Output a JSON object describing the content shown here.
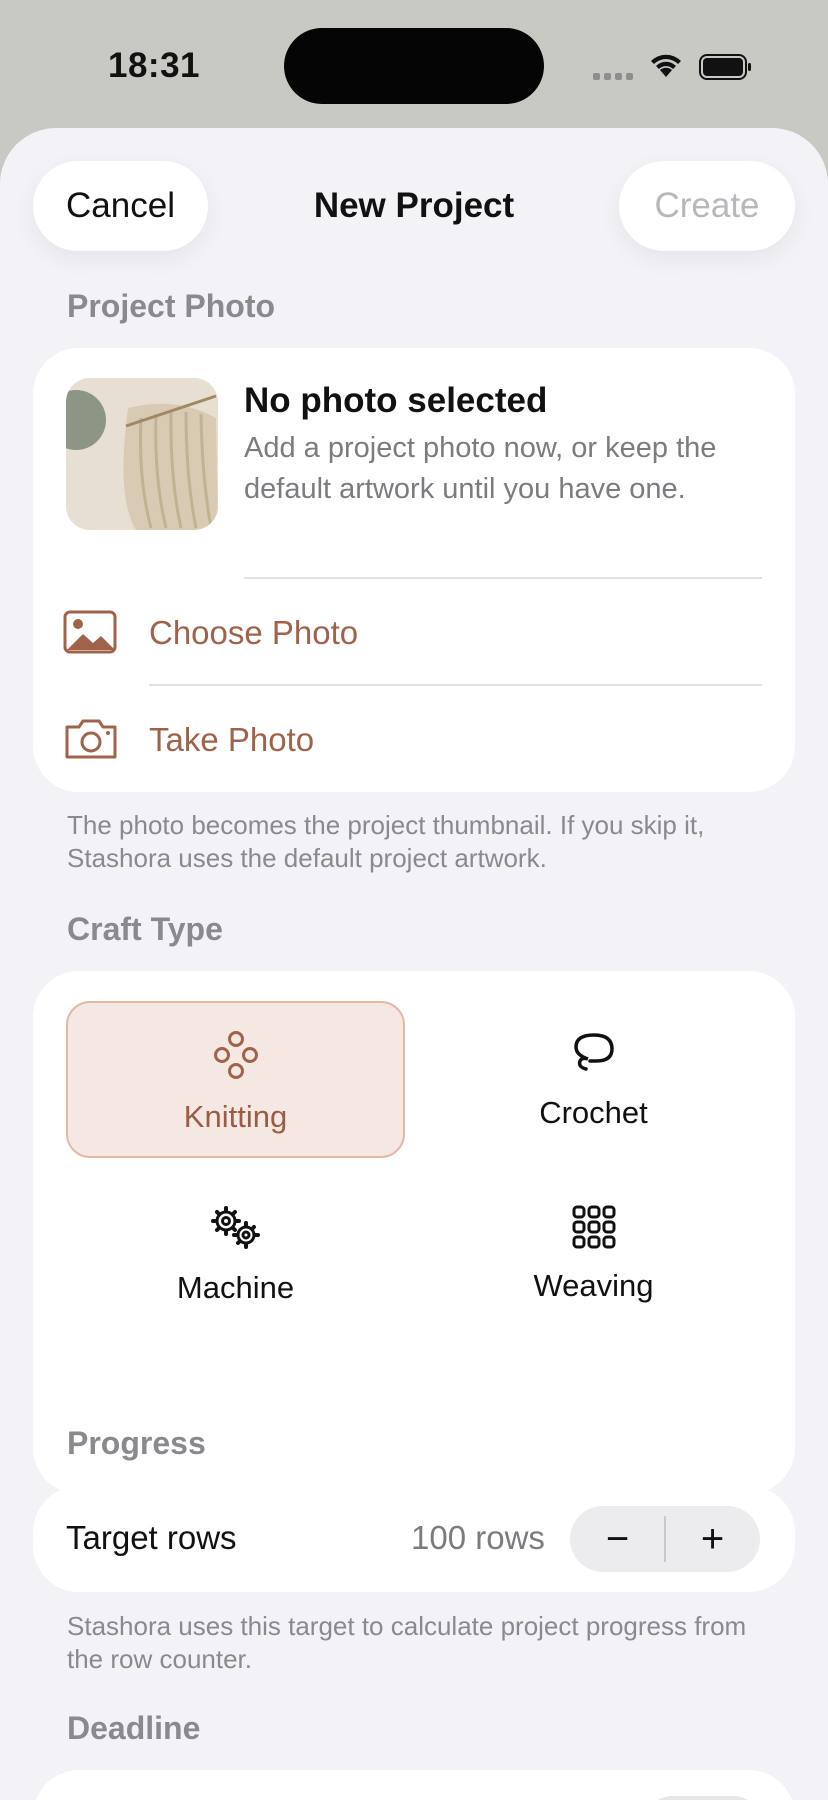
{
  "status_bar": {
    "time": "18:31"
  },
  "nav": {
    "cancel_label": "Cancel",
    "title": "New Project",
    "create_label": "Create"
  },
  "project_photo": {
    "header": "Project Photo",
    "title": "No photo selected",
    "description": "Add a project photo now, or keep the default artwork until you have one.",
    "choose_label": "Choose Photo",
    "take_label": "Take Photo",
    "footer": "The photo becomes the project thumbnail. If you skip it, Stashora uses the default project artwork."
  },
  "craft_type": {
    "header": "Craft Type",
    "options": [
      {
        "label": "Knitting",
        "icon": "knitting-icon",
        "selected": true
      },
      {
        "label": "Crochet",
        "icon": "crochet-icon",
        "selected": false
      },
      {
        "label": "Machine",
        "icon": "gears-icon",
        "selected": false
      },
      {
        "label": "Weaving",
        "icon": "grid-icon",
        "selected": false
      }
    ]
  },
  "progress": {
    "header": "Progress",
    "target_label": "Target rows",
    "target_value": "100 rows",
    "minus": "−",
    "plus": "+",
    "footer": "Stashora uses this target to calculate project progress from the row counter."
  },
  "deadline": {
    "header": "Deadline"
  },
  "colors": {
    "accent": "#a0634a",
    "selected_bg": "#f5e8e3",
    "background": "#f2f2f7"
  }
}
